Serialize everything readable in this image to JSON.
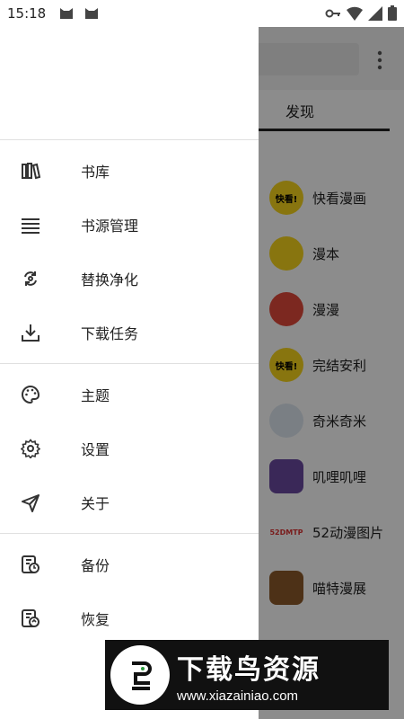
{
  "status_bar": {
    "time": "15:18"
  },
  "background_app": {
    "tab_label": "发现",
    "sources": [
      {
        "name": "快看漫画",
        "logo_text": "快看!",
        "logo_bg": "#f7d51d"
      },
      {
        "name": "漫本",
        "logo_text": "",
        "logo_bg": "#f7d51d"
      },
      {
        "name": "漫漫",
        "logo_text": "",
        "logo_bg": "#e24a3b"
      },
      {
        "name": "完结安利",
        "logo_text": "快看!",
        "logo_bg": "#f7d51d"
      },
      {
        "name": "奇米奇米",
        "logo_text": "",
        "logo_bg": "#dfe7f1"
      },
      {
        "name": "叽哩叽哩",
        "logo_text": "",
        "logo_bg": "#6b4aa0"
      },
      {
        "name": "52动漫图片",
        "logo_text": "52DMTP",
        "logo_bg": "#ffffff"
      },
      {
        "name": "喵特漫展",
        "logo_text": "",
        "logo_bg": "#8c5a2b"
      }
    ]
  },
  "drawer": {
    "groups": [
      {
        "items": [
          {
            "label": "书库",
            "icon": "bookshelf-icon"
          },
          {
            "label": "书源管理",
            "icon": "list-icon"
          },
          {
            "label": "替换净化",
            "icon": "refresh-search-icon"
          },
          {
            "label": "下载任务",
            "icon": "download-icon"
          }
        ]
      },
      {
        "items": [
          {
            "label": "主题",
            "icon": "palette-icon"
          },
          {
            "label": "设置",
            "icon": "gear-icon"
          },
          {
            "label": "关于",
            "icon": "send-icon"
          }
        ]
      },
      {
        "items": [
          {
            "label": "备份",
            "icon": "backup-icon"
          },
          {
            "label": "恢复",
            "icon": "restore-icon"
          }
        ]
      }
    ]
  },
  "watermark": {
    "title": "下载鸟资源",
    "url": "www.xiazainiao.com"
  }
}
